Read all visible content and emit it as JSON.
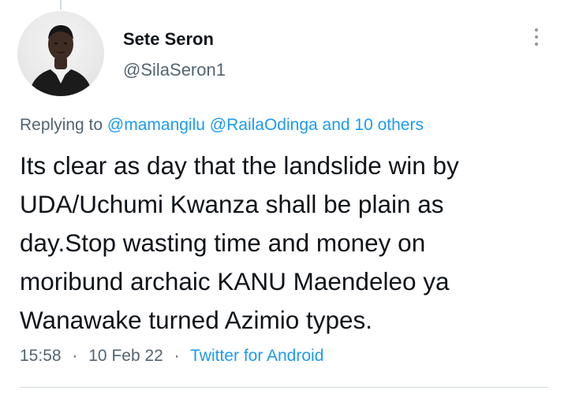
{
  "tweet": {
    "author": {
      "display_name": "Sete Seron",
      "handle": "@SilaSeron1",
      "avatar_icon": "profile-photo"
    },
    "replying_to": {
      "prefix": "Replying to",
      "mentions": [
        "@mamangilu",
        "@RailaOdinga"
      ],
      "others": "and 10 others"
    },
    "text_lines": [
      "Its clear as day that the landslide win by",
      "UDA/Uchumi Kwanza shall be plain as",
      "day.Stop wasting time and money on",
      "moribund archaic KANU Maendeleo ya",
      "Wanawake turned Azimio types."
    ],
    "meta": {
      "time": "15:58",
      "date": "10 Feb 22",
      "separator": "·",
      "source": "Twitter for Android"
    },
    "more_icon": "more-vertical-icon"
  },
  "colors": {
    "text": "#0f1419",
    "secondary": "#536471",
    "link": "#1d9bf0",
    "divider": "#cfd9de"
  }
}
